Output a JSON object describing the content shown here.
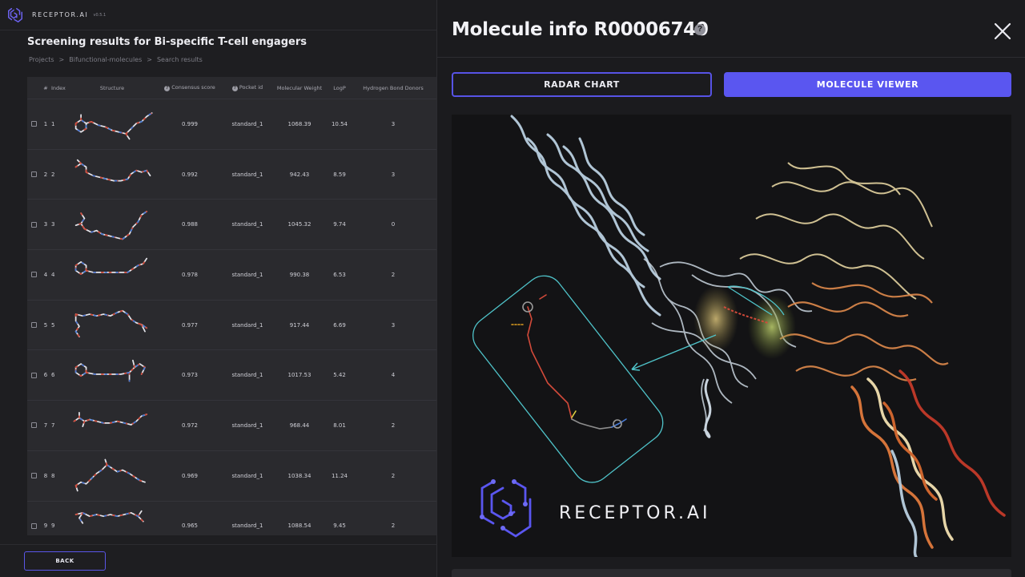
{
  "app": {
    "brand": "RECEPTOR.AI",
    "version": "v0.5.1"
  },
  "page": {
    "title": "Screening results for Bi-specific T-cell engagers",
    "breadcrumb": [
      "Projects",
      "Bifunctional-molecules",
      "Search results"
    ]
  },
  "table": {
    "columns": {
      "num": "#",
      "index": "Index",
      "structure": "Structure",
      "score": "Consensus score",
      "pocket": "Pocket id",
      "mw": "Molecular Weight",
      "logp": "LogP",
      "hbd": "Hydrogen Bond Donors"
    },
    "rows": [
      {
        "num": "1",
        "index": "1",
        "score": "0.999",
        "pocket": "standard_1",
        "mw": "1068.39",
        "logp": "10.54",
        "hbd": "3"
      },
      {
        "num": "2",
        "index": "2",
        "score": "0.992",
        "pocket": "standard_1",
        "mw": "942.43",
        "logp": "8.59",
        "hbd": "3"
      },
      {
        "num": "3",
        "index": "3",
        "score": "0.988",
        "pocket": "standard_1",
        "mw": "1045.32",
        "logp": "9.74",
        "hbd": "0"
      },
      {
        "num": "4",
        "index": "4",
        "score": "0.978",
        "pocket": "standard_1",
        "mw": "990.38",
        "logp": "6.53",
        "hbd": "2"
      },
      {
        "num": "5",
        "index": "5",
        "score": "0.977",
        "pocket": "standard_1",
        "mw": "917.44",
        "logp": "6.69",
        "hbd": "3"
      },
      {
        "num": "6",
        "index": "6",
        "score": "0.973",
        "pocket": "standard_1",
        "mw": "1017.53",
        "logp": "5.42",
        "hbd": "4"
      },
      {
        "num": "7",
        "index": "7",
        "score": "0.972",
        "pocket": "standard_1",
        "mw": "968.44",
        "logp": "8.01",
        "hbd": "2"
      },
      {
        "num": "8",
        "index": "8",
        "score": "0.969",
        "pocket": "standard_1",
        "mw": "1038.34",
        "logp": "11.24",
        "hbd": "2"
      },
      {
        "num": "9",
        "index": "9",
        "score": "0.965",
        "pocket": "standard_1",
        "mw": "1088.54",
        "logp": "9.45",
        "hbd": "2"
      }
    ]
  },
  "footer": {
    "back_label": "BACK"
  },
  "molecule": {
    "title": "Molecule info R00006740",
    "help_glyph": "?",
    "tabs": {
      "radar": "RADAR CHART",
      "viewer": "MOLECULE VIEWER"
    },
    "active_tab": "viewer",
    "viewer_brand": "RECEPTOR.AI"
  },
  "colors": {
    "accent": "#5a56f0",
    "background": "#1b1b1e",
    "panel": "#2a2a2e"
  }
}
